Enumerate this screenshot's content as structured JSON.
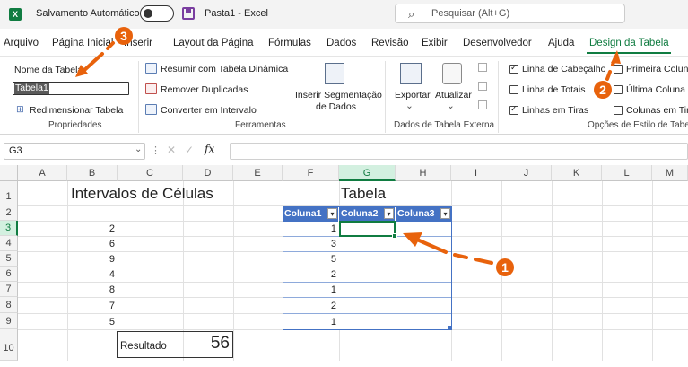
{
  "titlebar": {
    "app_icon": "X",
    "autosave_label": "Salvamento Automático",
    "autosave_toggle": "off",
    "document_title": "Pasta1  -  Excel",
    "search_placeholder": "Pesquisar (Alt+G)"
  },
  "menu": [
    "Arquivo",
    "Página Inicial",
    "Inserir",
    "Layout da Página",
    "Fórmulas",
    "Dados",
    "Revisão",
    "Exibir",
    "Desenvolvedor",
    "Ajuda",
    "Design da Tabela"
  ],
  "ribbon": {
    "properties": {
      "table_name_label": "Nome da Tabela:",
      "table_name_value": "Tabela1",
      "resize_label": "Redimensionar Tabela",
      "group_label": "Propriedades"
    },
    "tools": {
      "pivot_label": "Resumir com Tabela Dinâmica",
      "remove_dupes_label": "Remover Duplicadas",
      "convert_label": "Converter em Intervalo",
      "slicer_label_1": "Inserir Segmentação",
      "slicer_label_2": "de Dados",
      "group_label": "Ferramentas"
    },
    "external": {
      "export_label": "Exportar",
      "refresh_label": "Atualizar",
      "group_label": "Dados de Tabela Externa"
    },
    "style_options": {
      "header_row": "Linha de Cabeçalho",
      "total_row": "Linha de Totais",
      "banded_rows": "Linhas em Tiras",
      "first_column": "Primeira Colun",
      "last_column": "Última Coluna",
      "banded_columns": "Colunas em Tir",
      "group_label": "Opções de Estilo de Tabe",
      "checked": {
        "header_row": true,
        "total_row": false,
        "banded_rows": true,
        "first_column": false,
        "last_column": false,
        "banded_columns": false
      }
    }
  },
  "formula_bar": {
    "name_box": "G3",
    "fx": "fx",
    "value": ""
  },
  "grid": {
    "columns": [
      "A",
      "B",
      "C",
      "D",
      "E",
      "F",
      "G",
      "H",
      "I",
      "J",
      "K",
      "L",
      "M"
    ],
    "rows": [
      "1",
      "2",
      "3",
      "4",
      "5",
      "6",
      "7",
      "8",
      "9",
      "10"
    ],
    "selected_cell": "G3",
    "title_b1": "Intervalos de Células",
    "title_g1": "Tabela",
    "col_b_values": [
      "2",
      "6",
      "9",
      "4",
      "8",
      "7",
      "5"
    ],
    "table_headers": [
      "Coluna1",
      "Coluna2",
      "Coluna3"
    ],
    "table_col1_values": [
      "1",
      "3",
      "5",
      "2",
      "1",
      "2",
      "1"
    ],
    "result_label": "Resultado",
    "result_value": "56"
  },
  "callouts": [
    "1",
    "2",
    "3"
  ],
  "colors": {
    "accent": "#107c41",
    "table_header": "#4472c4",
    "callout": "#e8620c"
  }
}
